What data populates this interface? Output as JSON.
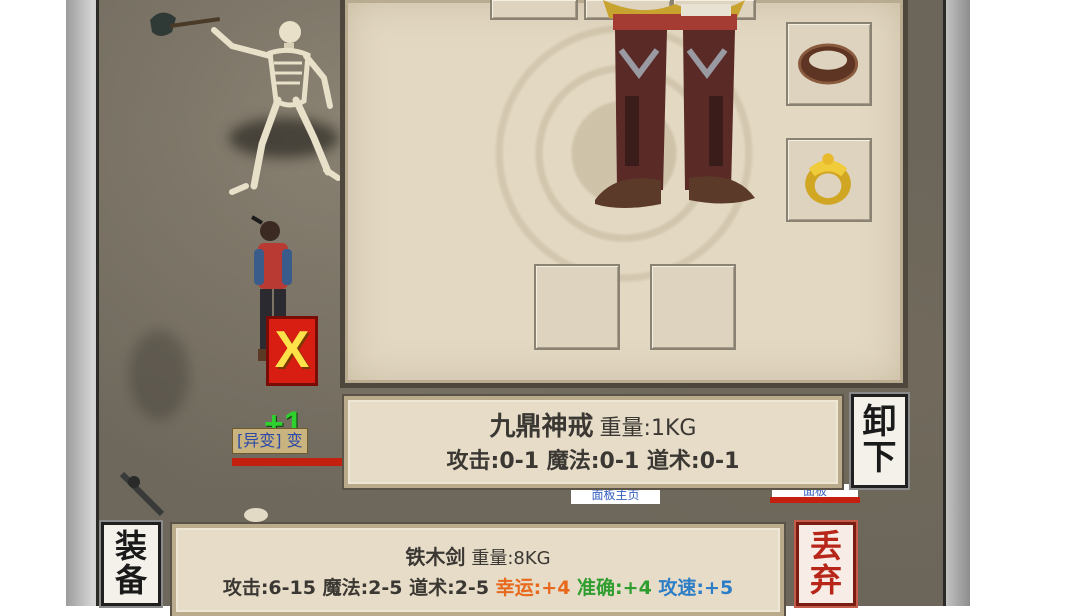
{
  "scene": {
    "overlay_badge_text": "X",
    "float_text": "+1",
    "player_tag": "[异变] 变",
    "strip_text_1": "面板主页",
    "strip_text_2": "面板"
  },
  "equip_panel": {
    "top_slots": [
      "",
      "",
      ""
    ],
    "right_slots": [
      "bracelet-icon",
      "ring-icon"
    ],
    "bottom_slots": [
      "",
      ""
    ]
  },
  "selected_item": {
    "name": "九鼎神戒",
    "weight_label": "重量:",
    "weight_value": "1KG",
    "stats": "攻击:0-1 魔法:0-1 道术:0-1"
  },
  "unequip_button": {
    "chars": [
      "卸",
      "下"
    ]
  },
  "bag_item": {
    "name": "铁木剑",
    "weight_label": "重量:",
    "weight_value": "8KG",
    "stats_base": "攻击:6-15 魔法:2-5 道术:2-5",
    "stat_luck": "幸运:+4",
    "stat_accuracy": "准确:+4",
    "stat_speed": "攻速:+5"
  },
  "equip_button": {
    "chars": [
      "装",
      "备"
    ]
  },
  "drop_button": {
    "chars": [
      "丢",
      "弃"
    ]
  },
  "colors": {
    "panel_bg": "#e3d8c2",
    "close_red": "#d81d12",
    "luck_orange": "#e8681c",
    "accuracy_green": "#2f9e2f",
    "speed_blue": "#2d7ec7"
  }
}
